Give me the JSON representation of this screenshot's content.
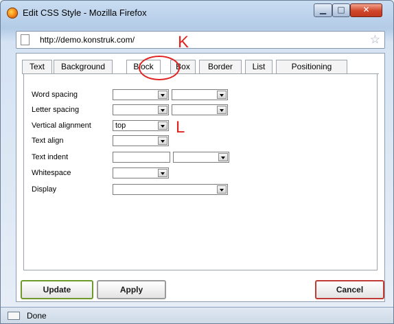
{
  "window": {
    "title": "Edit CSS Style - Mozilla Firefox"
  },
  "address": {
    "url": "http://demo.konstruk.com/"
  },
  "annotations": {
    "k": "K",
    "l": "L"
  },
  "tabs": [
    {
      "label": "Text"
    },
    {
      "label": "Background"
    },
    {
      "label": "Block",
      "active": true
    },
    {
      "label": "Box"
    },
    {
      "label": "Border"
    },
    {
      "label": "List"
    },
    {
      "label": "Positioning"
    }
  ],
  "form": {
    "word_spacing": {
      "label": "Word spacing",
      "value": "",
      "unit": ""
    },
    "letter_spacing": {
      "label": "Letter spacing",
      "value": "",
      "unit": ""
    },
    "vertical_alignment": {
      "label": "Vertical alignment",
      "value": "top"
    },
    "text_align": {
      "label": "Text align",
      "value": ""
    },
    "text_indent": {
      "label": "Text indent",
      "value": "",
      "unit": ""
    },
    "whitespace": {
      "label": "Whitespace",
      "value": ""
    },
    "display": {
      "label": "Display",
      "value": ""
    }
  },
  "buttons": {
    "update": "Update",
    "apply": "Apply",
    "cancel": "Cancel"
  },
  "status": {
    "text": "Done"
  },
  "colors": {
    "annotation": "#e0231f",
    "update_border": "#6b9a2a",
    "cancel_border": "#c03a34"
  }
}
